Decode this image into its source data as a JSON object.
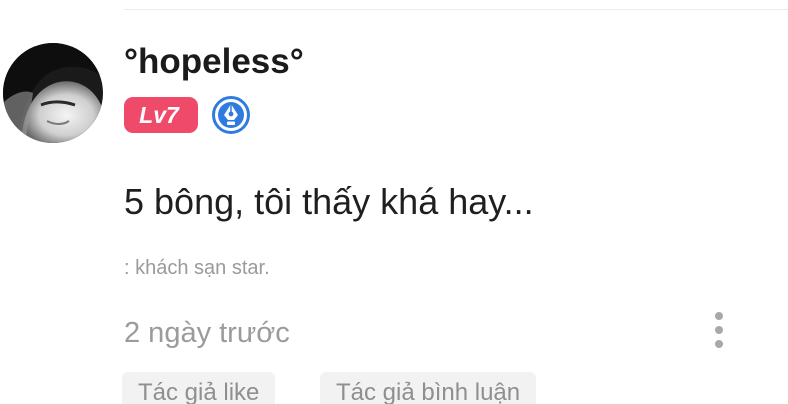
{
  "comment": {
    "user": {
      "username": "°hopeless°",
      "level": "Lv7",
      "role_icon": "pen-badge-icon"
    },
    "text": "5 bông, tôi thấy khá hay...",
    "reference": ": khách sạn star.",
    "timestamp": "2 ngày trước",
    "more_icon": "more-vertical-icon",
    "tags": [
      {
        "label": "Tác giả like"
      },
      {
        "label": "Tác giả bình luận"
      }
    ]
  },
  "colors": {
    "level_badge": "#ef4a6a",
    "role_icon": "#2f7be0",
    "text_primary": "#1b1b1b",
    "text_secondary": "#9b9b9b",
    "tag_background": "#f2f2f2"
  }
}
